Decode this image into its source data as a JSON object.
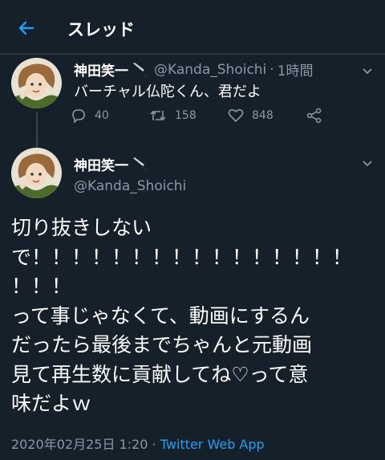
{
  "header": {
    "title": "スレッド",
    "back_icon": "arrow-left-icon"
  },
  "colors": {
    "background": "#15202b",
    "accent": "#1da1f2",
    "secondary_text": "#8899a6",
    "divider": "#38444d"
  },
  "parent_tweet": {
    "display_name": "神田笑一",
    "name_emoji": "knife-icon",
    "handle": "@Kanda_Shoichi",
    "separator": "·",
    "time": "1時間",
    "text": "バーチャル仏陀くん、君だよ",
    "actions": {
      "reply_count": "40",
      "retweet_count": "158",
      "like_count": "848"
    }
  },
  "main_tweet": {
    "display_name": "神田笑一",
    "name_emoji": "knife-icon",
    "handle": "@Kanda_Shoichi",
    "text_lines": [
      "切り抜きしない",
      "で！！！！！！！！！！！！！！！！",
      "！！！",
      "って事じゃなくて、動画にするん",
      "だったら最後までちゃんと元動画",
      "見て再生数に貢献してね♡って意",
      "味だよｗ"
    ],
    "timestamp": "2020年02月25日 1:20",
    "separator": "·",
    "source": "Twitter Web App"
  }
}
